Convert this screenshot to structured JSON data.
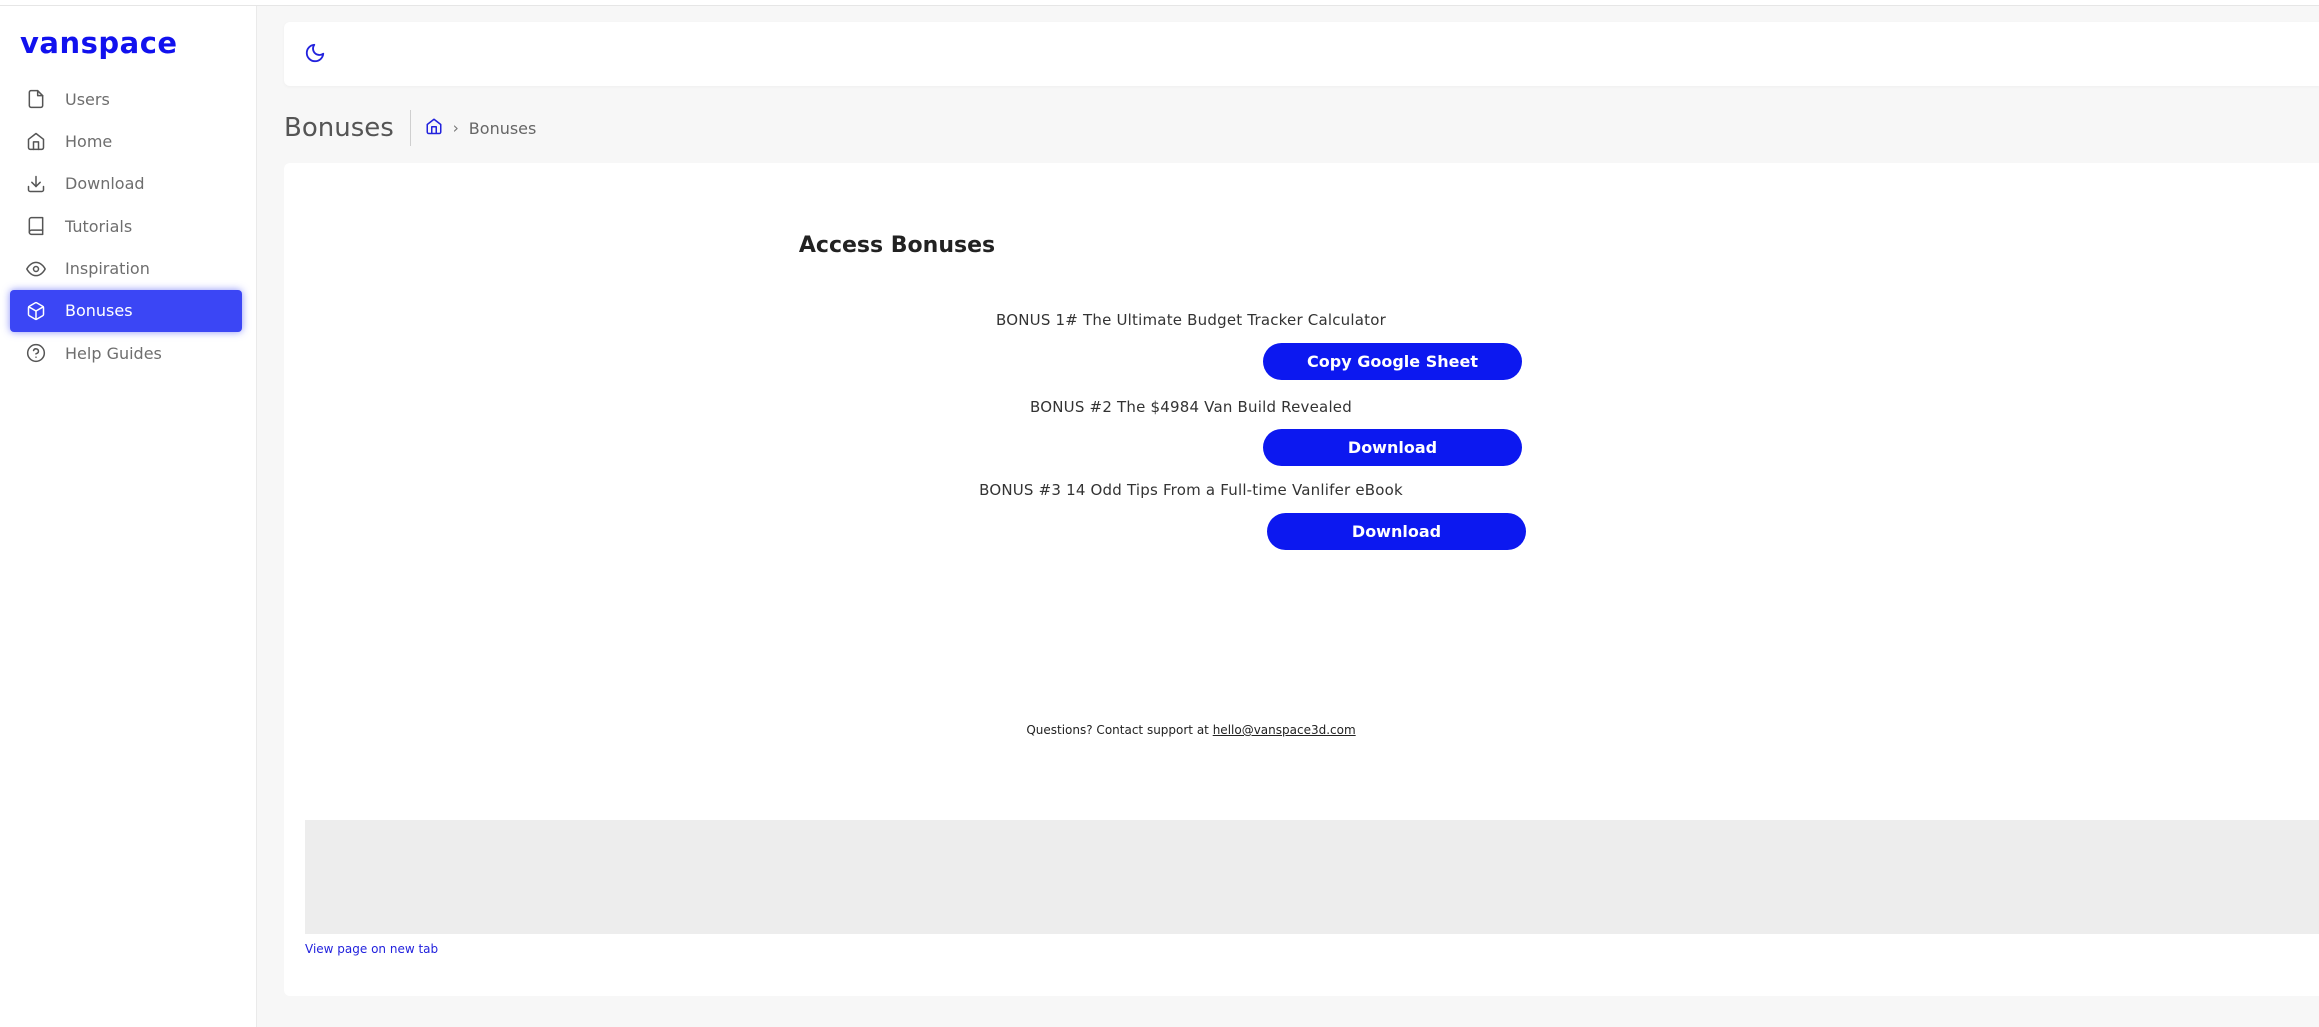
{
  "app": {
    "logo": "vanspace",
    "accent_color": "#0c18f0"
  },
  "sidebar": {
    "items": [
      {
        "label": "Users",
        "icon": "file-icon"
      },
      {
        "label": "Home",
        "icon": "home-icon"
      },
      {
        "label": "Download",
        "icon": "download-icon"
      },
      {
        "label": "Tutorials",
        "icon": "book-icon"
      },
      {
        "label": "Inspiration",
        "icon": "eye-icon"
      },
      {
        "label": "Bonuses",
        "icon": "box-icon",
        "active": true
      },
      {
        "label": "Help Guides",
        "icon": "help-circle-icon"
      }
    ]
  },
  "topbar": {
    "theme_toggle_icon": "moon-icon"
  },
  "header": {
    "title": "Bonuses",
    "breadcrumb": {
      "home_icon": "home-icon",
      "current": "Bonuses"
    }
  },
  "main": {
    "heading": "Access Bonuses",
    "bonuses": [
      {
        "label": "BONUS 1# The Ultimate Budget Tracker Calculator",
        "button": "Copy Google Sheet"
      },
      {
        "label": "BONUS #2 The $4984 Van Build Revealed",
        "button": "Download"
      },
      {
        "label": "BONUS #3 14 Odd Tips From a Full-time Vanlifer eBook",
        "button": "Download"
      }
    ],
    "support_text": "Questions? Contact support at ",
    "support_email": "hello@vanspace3d.com",
    "view_link": "View page on new tab"
  }
}
